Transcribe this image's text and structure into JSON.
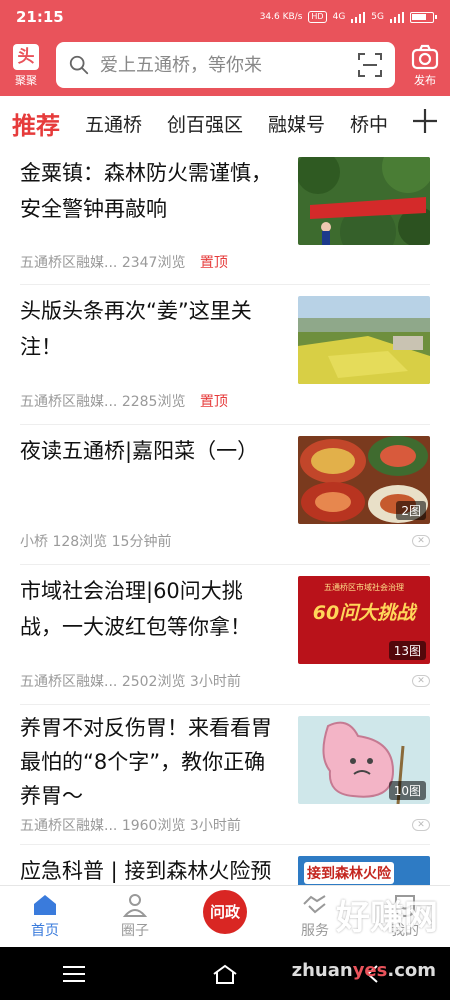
{
  "status_bar": {
    "time": "21:15",
    "speed": "34.6 KB/s",
    "hd": "HD",
    "net_a": "4G",
    "net_b": "5G"
  },
  "header": {
    "logo_char": "头",
    "logo_label": "聚聚",
    "search_placeholder": "爱上五通桥，等你来",
    "publish_label": "发布"
  },
  "tabs": [
    {
      "label": "推荐",
      "active": true
    },
    {
      "label": "五通桥"
    },
    {
      "label": "创百强区"
    },
    {
      "label": "融媒号"
    },
    {
      "label": "桥中"
    }
  ],
  "feed": [
    {
      "title": "金粟镇：森林防火需谨慎，安全警钟再敲响",
      "source": "五通桥区融媒...",
      "views": "2347浏览",
      "pinned": "置顶",
      "thumb": "forest-fire-banner",
      "banner_text": "强化野外火源管控 护美丽公园城市"
    },
    {
      "title": "头版头条再次“姜”这里关注！",
      "source": "五通桥区融媒...",
      "views": "2285浏览",
      "pinned": "置顶",
      "thumb": "aerial-fields"
    },
    {
      "title": "夜读五通桥|嘉阳菜（一）",
      "source": "小桥",
      "views": "128浏览",
      "time": "15分钟前",
      "thumb": "food-dishes",
      "img_count": "2图"
    },
    {
      "title": "市域社会治理|60问大挑战，一大波红包等你拿！",
      "source": "五通桥区融媒...",
      "views": "2502浏览",
      "time": "3小时前",
      "thumb": "challenge-poster",
      "poster_title": "五通桥区市域社会治理",
      "poster_big": "60问大挑战",
      "img_count": "13图"
    },
    {
      "title": "养胃不对反伤胃！来看看胃最怕的“8个字”，教你正确养胃～",
      "source": "五通桥区融媒...",
      "views": "1960浏览",
      "time": "3小时前",
      "thumb": "stomach-cartoon",
      "img_count": "10图"
    },
    {
      "title": "应急科普 | 接到森林火险预",
      "thumb": "forest-fire-alert",
      "poster_text": "接到森林火险"
    }
  ],
  "bottom_nav": [
    {
      "label": "首页",
      "icon": "home-icon",
      "active": true
    },
    {
      "label": "圈子",
      "icon": "circle-icon"
    },
    {
      "label": "问政",
      "icon": "wenzheng-icon"
    },
    {
      "label": "服务",
      "icon": "handshake-icon"
    },
    {
      "label": "我的",
      "icon": "face-icon"
    }
  ],
  "watermark": {
    "text": "好赚网",
    "url_a": "zhuan",
    "url_b": "yes",
    "url_c": ".com"
  },
  "colors": {
    "brand_red": "#e9535b",
    "accent_red": "#e63b3b",
    "nav_blue": "#3a7bdc"
  }
}
